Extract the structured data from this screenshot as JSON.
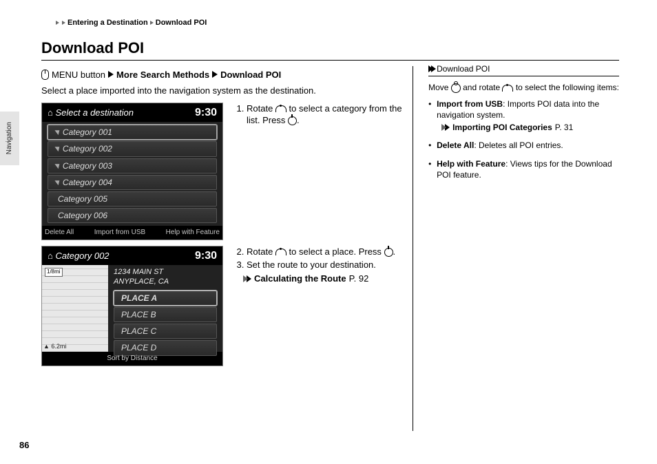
{
  "breadcrumb": {
    "a": "Entering a Destination",
    "b": "Download POI"
  },
  "side_tab": "Navigation",
  "title": "Download POI",
  "menu_path": {
    "btn": "MENU button",
    "b1": "More Search Methods",
    "b2": "Download POI"
  },
  "intro": "Select a place imported into the navigation system as the destination.",
  "screen1": {
    "header": "Select a destination",
    "clock": "9:30",
    "items": [
      "Category 001",
      "Category 002",
      "Category 003",
      "Category 004",
      "Category 005",
      "Category 006"
    ],
    "foot": {
      "a": "Delete All",
      "b": "Import from USB",
      "c": "Help with Feature"
    }
  },
  "steps1": {
    "s1a": "Rotate ",
    "s1b": " to select a category from the list. Press ",
    "s1c": "."
  },
  "screen2": {
    "header": "Category 002",
    "clock": "9:30",
    "addr1": "1234 MAIN ST",
    "addr2": "ANYPLACE, CA",
    "scale": "1/8mi",
    "dist": "6.2mi",
    "items": [
      "PLACE A",
      "PLACE B",
      "PLACE C",
      "PLACE D"
    ],
    "foot": "Sort by Distance"
  },
  "steps2": {
    "s2a": "Rotate ",
    "s2b": " to select a place. Press ",
    "s2c": ".",
    "s3": "Set the route to your destination.",
    "ref": "Calculating the Route",
    "refp": "P. 92"
  },
  "right": {
    "hdr": "Download POI",
    "lead_a": "Move ",
    "lead_b": " and rotate ",
    "lead_c": " to select the following items:",
    "li1t": "Import from USB",
    "li1": ": Imports POI data into the navigation system.",
    "li1ref": "Importing POI Categories",
    "li1refp": "P. 31",
    "li2t": "Delete All",
    "li2": ": Deletes all POI entries.",
    "li3t": "Help with Feature",
    "li3": ": Views tips for the Download POI feature."
  },
  "page_num": "86"
}
